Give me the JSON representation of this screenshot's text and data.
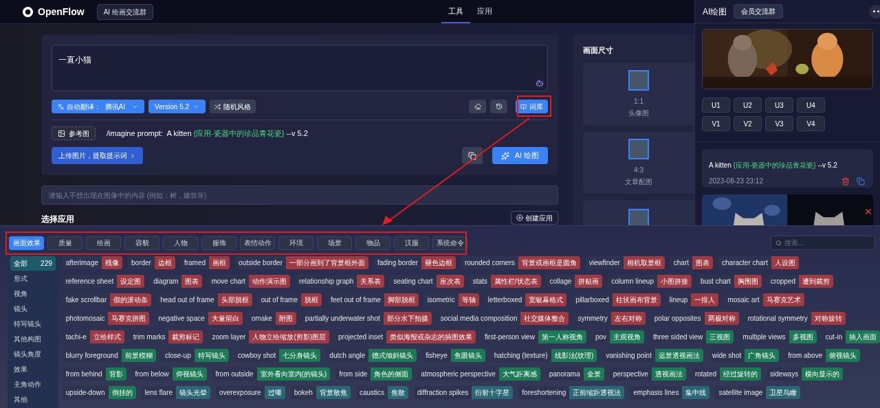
{
  "header": {
    "logo": "OpenFlow",
    "group_badge": "AI 绘画交流群",
    "nav": [
      {
        "label": "工具",
        "selected": true
      },
      {
        "label": "应用",
        "selected": false
      }
    ]
  },
  "prompt_panel": {
    "prompt_text": "一直小猫",
    "translate_button": "自动翻译：  腾讯AI",
    "version_button": "Version 5.2",
    "random_button": "随机风格",
    "library_button": "词库",
    "reference_button": "参考图",
    "command_prefix": "/imagine prompt:  A kitten",
    "command_highlight": "{应用-瓷器中的珍品青花瓷}",
    "command_suffix": "--v 5.2",
    "upload_button": "上传图片，提取提示词",
    "draw_button": "AI 绘图"
  },
  "negative_prompt": {
    "placeholder": "请输入不想出现在图像中的内容 (例如：树，建筑等)"
  },
  "apps_section": {
    "title": "选择应用",
    "create_button": "创建应用"
  },
  "size_panel": {
    "title": "画面尺寸",
    "options": [
      {
        "ratio": "1:1",
        "label": "头像图"
      },
      {
        "ratio": "4:3",
        "label": "文章配图"
      }
    ]
  },
  "drawing_panel": {
    "title": "AI绘图",
    "group_button": "会员交流群",
    "upscale_buttons": [
      "U1",
      "U2",
      "U3",
      "U4"
    ],
    "variation_buttons": [
      "V1",
      "V2",
      "V3",
      "V4"
    ],
    "history": [
      {
        "prompt": "A kitten",
        "highlight": "{应用-瓷器中的珍品青花瓷}",
        "suffix": "--v 5.2",
        "time": "2023-08-23 23:12"
      }
    ]
  },
  "library_popup": {
    "categories": [
      {
        "label": "画面效果",
        "selected": true
      },
      {
        "label": "质量",
        "selected": false
      },
      {
        "label": "绘画",
        "selected": false
      },
      {
        "label": "容貌",
        "selected": false
      },
      {
        "label": "人物",
        "selected": false
      },
      {
        "label": "服饰",
        "selected": false
      },
      {
        "label": "表情动作",
        "selected": false
      },
      {
        "label": "环境",
        "selected": false
      },
      {
        "label": "场景",
        "selected": false
      },
      {
        "label": "物品",
        "selected": false
      },
      {
        "label": "汉服",
        "selected": false
      },
      {
        "label": "系统命令",
        "selected": false
      }
    ],
    "search": {
      "placeholder": "搜索..."
    },
    "groups": [
      {
        "label": "全部",
        "count": "229",
        "selected": true
      },
      {
        "label": "形式",
        "selected": false
      },
      {
        "label": "视角",
        "selected": false
      },
      {
        "label": "镜头",
        "selected": false
      },
      {
        "label": "特写镜头",
        "selected": false
      },
      {
        "label": "其他构图",
        "selected": false
      },
      {
        "label": "镜头角度",
        "selected": false
      },
      {
        "label": "效果",
        "selected": false
      },
      {
        "label": "主角动作",
        "selected": false
      },
      {
        "label": "其他",
        "selected": false
      }
    ],
    "tag_rows": [
      [
        {
          "en": "afterimage",
          "zh": "残像",
          "color": "#9e3a43"
        },
        {
          "en": "border",
          "zh": "边框",
          "color": "#9e3a43"
        },
        {
          "en": "framed",
          "zh": "画框",
          "color": "#9e3a43"
        },
        {
          "en": "outside border",
          "zh": "一部分画到了背景框外面",
          "color": "#9e3a43"
        },
        {
          "en": "fading border",
          "zh": "褪色边框",
          "color": "#9e3a43"
        },
        {
          "en": "rounded corners",
          "zh": "背景或画框是圆角",
          "color": "#9e3a43"
        },
        {
          "en": "viewfinder",
          "zh": "相机取景框",
          "color": "#9e3a43"
        },
        {
          "en": "chart",
          "zh": "图表",
          "color": "#9e3a43"
        },
        {
          "en": "character chart",
          "zh": "人设图",
          "color": "#9e3a43"
        }
      ],
      [
        {
          "en": "reference sheet",
          "zh": "设定图",
          "color": "#9e3a43"
        },
        {
          "en": "diagram",
          "zh": "图表",
          "color": "#9e3a43"
        },
        {
          "en": "move chart",
          "zh": "动作演示图",
          "color": "#9e3a43"
        },
        {
          "en": "relationship graph",
          "zh": "关系表",
          "color": "#9e3a43"
        },
        {
          "en": "seating chart",
          "zh": "座次表",
          "color": "#9e3a43"
        },
        {
          "en": "stats",
          "zh": "属性栏/状态表",
          "color": "#9e3a43"
        },
        {
          "en": "collage",
          "zh": "拼贴画",
          "color": "#9e3a43"
        },
        {
          "en": "column lineup",
          "zh": "小图拼接",
          "color": "#9e3a43"
        },
        {
          "en": "bust chart",
          "zh": "胸围图",
          "color": "#9e3a43"
        },
        {
          "en": "cropped",
          "zh": "遭到裁剪",
          "color": "#9e3a43"
        }
      ],
      [
        {
          "en": "fake scrollbar",
          "zh": "假的滚动条",
          "color": "#9e3a43"
        },
        {
          "en": "head out of frame",
          "zh": "头部脱框",
          "color": "#9e3a43"
        },
        {
          "en": "out of frame",
          "zh": "脱框",
          "color": "#9e3a43"
        },
        {
          "en": "feet out of frame",
          "zh": "脚部脱框",
          "color": "#9e3a43"
        },
        {
          "en": "isometric",
          "zh": "等轴",
          "color": "#9e3a43"
        },
        {
          "en": "letterboxed",
          "zh": "宽银幕格式",
          "color": "#9e3a43"
        },
        {
          "en": "pillarboxed",
          "zh": "柱状画布背景",
          "color": "#9e3a43"
        },
        {
          "en": "lineup",
          "zh": "一排人",
          "color": "#9e3a43"
        },
        {
          "en": "mosaic art",
          "zh": "马赛克艺术",
          "color": "#9e3a43"
        }
      ],
      [
        {
          "en": "photomosaic",
          "zh": "马赛克拼图",
          "color": "#9e3a43"
        },
        {
          "en": "negative space",
          "zh": "大量留白",
          "color": "#9e3a43"
        },
        {
          "en": "omake",
          "zh": "附图",
          "color": "#9e3a43"
        },
        {
          "en": "partially underwater shot",
          "zh": "部分水下拍摄",
          "color": "#9e3a43"
        },
        {
          "en": "social media composition",
          "zh": "社交媒体整合",
          "color": "#9e3a43"
        },
        {
          "en": "symmetry",
          "zh": "左右对称",
          "color": "#9e3a43"
        },
        {
          "en": "polar opposites",
          "zh": "两极对称",
          "color": "#9e3a43"
        },
        {
          "en": "rotational symmetry",
          "zh": "对称旋转",
          "color": "#9e3a43"
        }
      ],
      [
        {
          "en": "tachi-e",
          "zh": "立绘样式",
          "color": "#9e3a43"
        },
        {
          "en": "trim marks",
          "zh": "裁剪标记",
          "color": "#9e3a43"
        },
        {
          "en": "zoom layer",
          "zh": "人物立绘缩放(剪影)图层",
          "color": "#9e3a43"
        },
        {
          "en": "projected inset",
          "zh": "类似海报或杂志的插图效果",
          "color": "#9e3a43"
        },
        {
          "en": "first-person view",
          "zh": "第一人称视角",
          "color": "#1c7a55"
        },
        {
          "en": "pov",
          "zh": "主观视角",
          "color": "#1c7a55"
        },
        {
          "en": "three sided view",
          "zh": "三视图",
          "color": "#1c7a55"
        },
        {
          "en": "multiple views",
          "zh": "多视图",
          "color": "#1c7a55"
        },
        {
          "en": "cut-in",
          "zh": "插入画面",
          "color": "#1c7a55"
        }
      ],
      [
        {
          "en": "blurry foreground",
          "zh": "前景模糊",
          "color": "#1c7a55"
        },
        {
          "en": "close-up",
          "zh": "特写镜头",
          "color": "#1c7a55"
        },
        {
          "en": "cowboy shot",
          "zh": "七分身镜头",
          "color": "#1c7a55"
        },
        {
          "en": "dutch angle",
          "zh": "德式倾斜镜头",
          "color": "#1c7a55"
        },
        {
          "en": "fisheye",
          "zh": "鱼眼镜头",
          "color": "#1c7a55"
        },
        {
          "en": "hatching (texture)",
          "zh": "线影法(纹理)",
          "color": "#1c7a55"
        },
        {
          "en": "vanishing point",
          "zh": "远景透视画法",
          "color": "#1c7a55"
        },
        {
          "en": "wide shot",
          "zh": "广角镜头",
          "color": "#1c7a55"
        },
        {
          "en": "from above",
          "zh": "俯视镜头",
          "color": "#1c7a55"
        }
      ],
      [
        {
          "en": "from behind",
          "zh": "背影",
          "color": "#1c7a55"
        },
        {
          "en": "from below",
          "zh": "仰视镜头",
          "color": "#1c7a55"
        },
        {
          "en": "from outside",
          "zh": "室外看向室内(的镜头)",
          "color": "#1c7a55"
        },
        {
          "en": "from side",
          "zh": "角色的侧面",
          "color": "#1c7a55"
        },
        {
          "en": "atmospheric perspective",
          "zh": "大气距离感",
          "color": "#1c7a55"
        },
        {
          "en": "panorama",
          "zh": "全景",
          "color": "#1c7a55"
        },
        {
          "en": "perspective",
          "zh": "透视画法",
          "color": "#1c7a55"
        },
        {
          "en": "rotated",
          "zh": "经过旋转的",
          "color": "#1c7a55"
        },
        {
          "en": "sideways",
          "zh": "横向显示的",
          "color": "#1c7a55"
        }
      ],
      [
        {
          "en": "upside-down",
          "zh": "倒挂的",
          "color": "#1c7a55"
        },
        {
          "en": "lens flare",
          "zh": "镜头光晕",
          "color": "#2b6875"
        },
        {
          "en": "overexposure",
          "zh": "过曝",
          "color": "#2b6875"
        },
        {
          "en": "bokeh",
          "zh": "背景散焦",
          "color": "#2b6875"
        },
        {
          "en": "caustics",
          "zh": "焦散",
          "color": "#2b6875"
        },
        {
          "en": "diffraction spikes",
          "zh": "衍射十字星",
          "color": "#2b6875"
        },
        {
          "en": "foreshortening",
          "zh": "正前缩距透视法",
          "color": "#2b6875"
        },
        {
          "en": "emphasis lines",
          "zh": "集中线",
          "color": "#2b6875"
        },
        {
          "en": "satellite image",
          "zh": "卫星鸟瞰",
          "color": "#2b6875"
        }
      ]
    ]
  }
}
